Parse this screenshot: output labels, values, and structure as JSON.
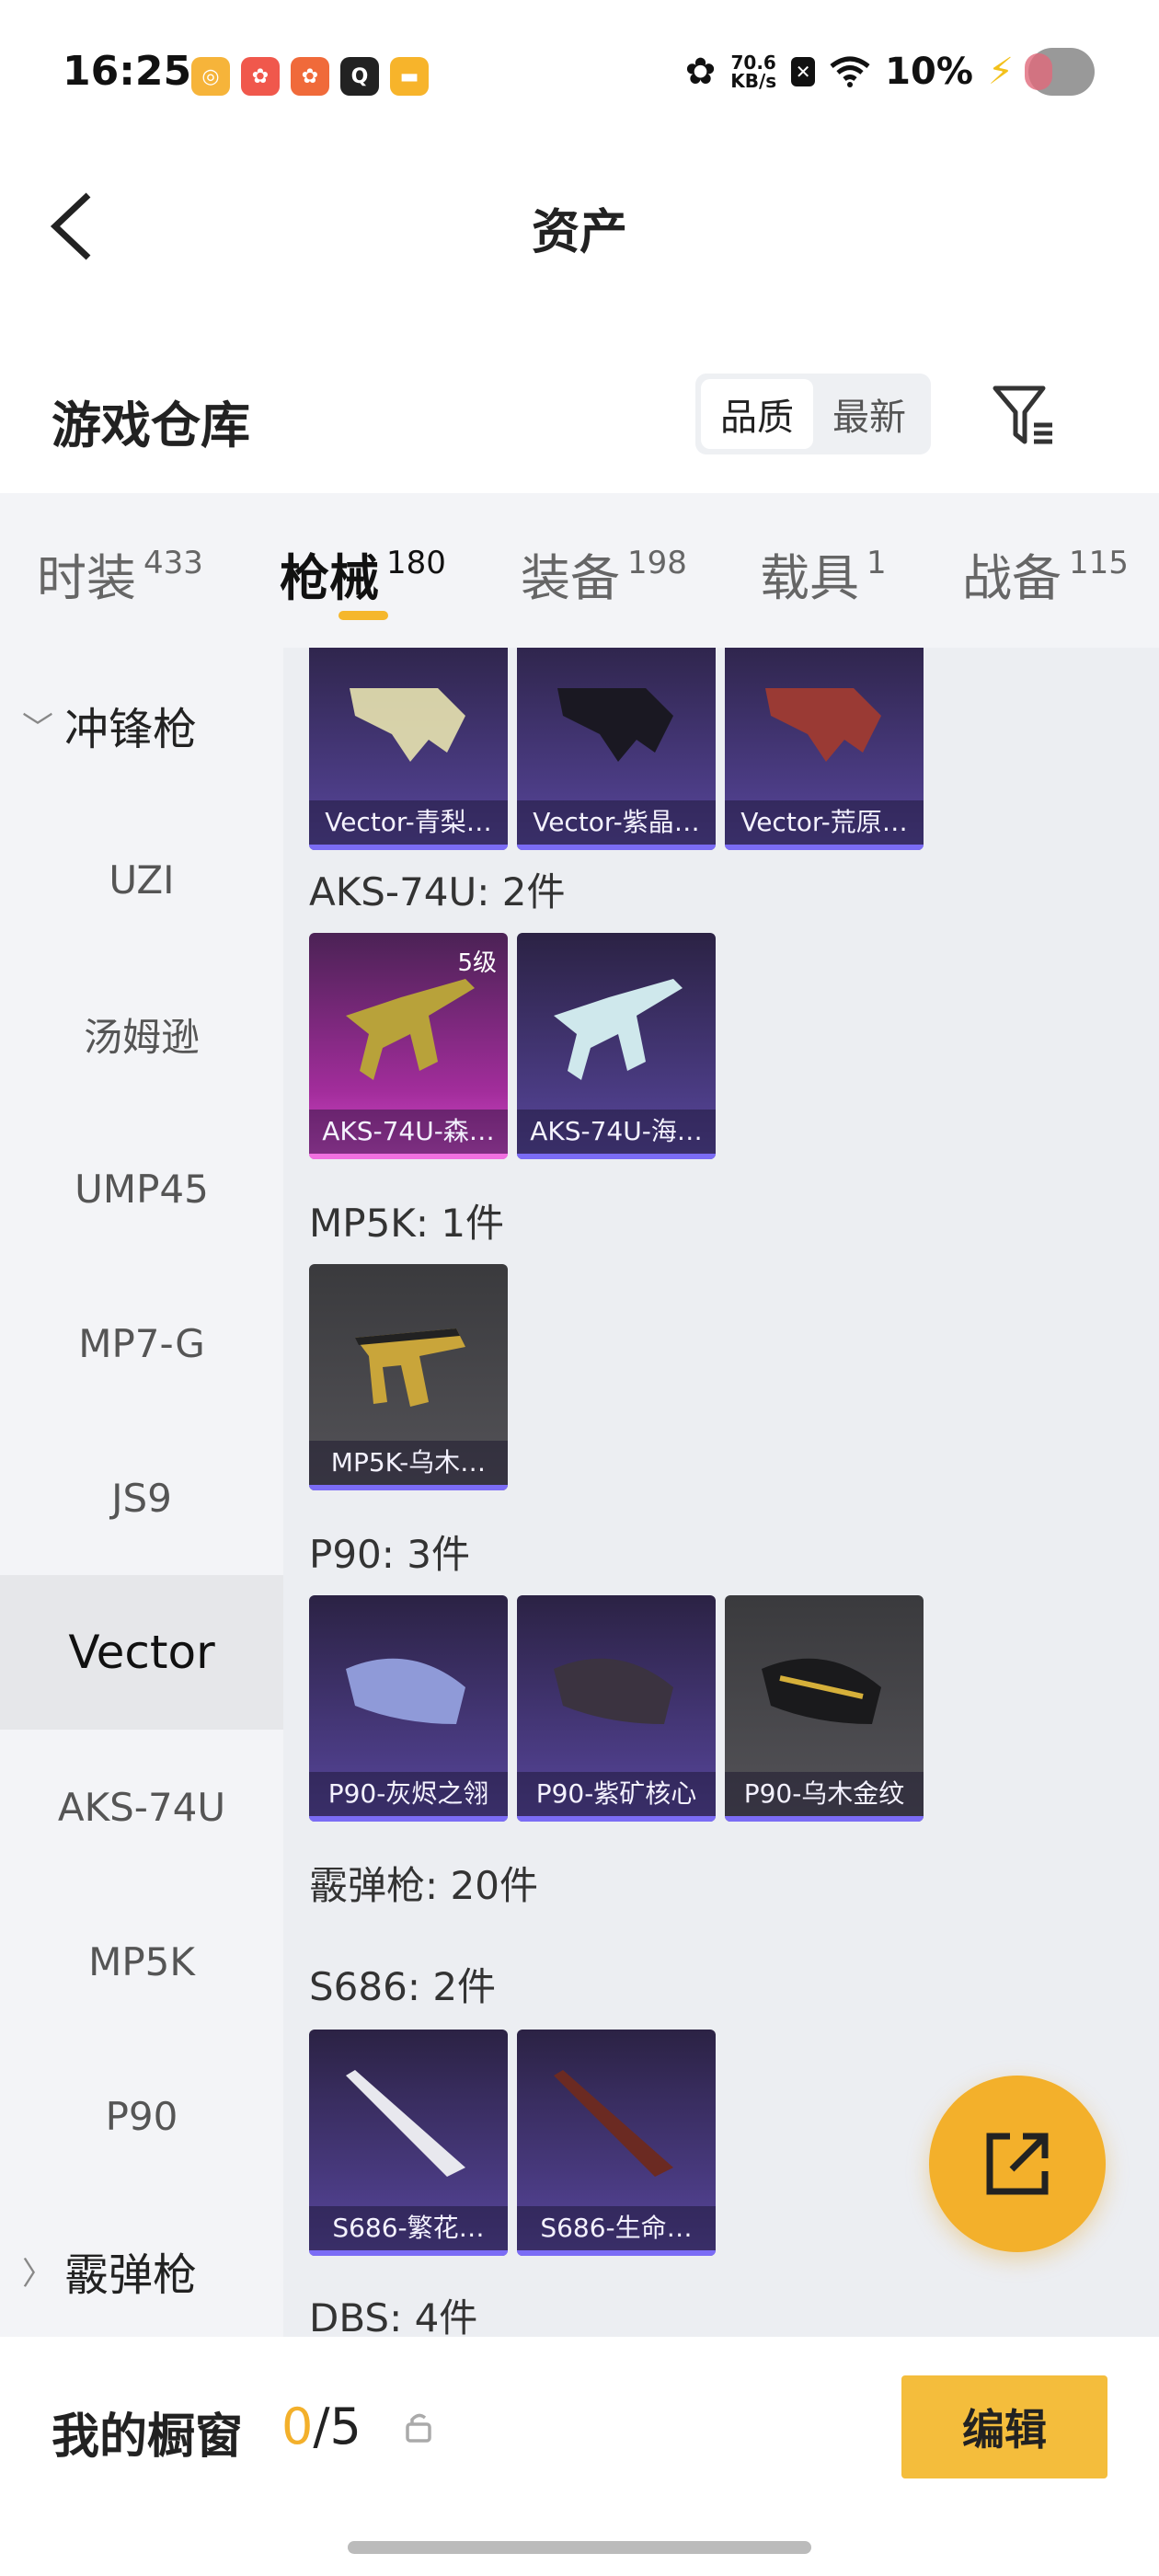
{
  "status_bar": {
    "time": "16:25",
    "net_speed_value": "70.6",
    "net_speed_unit": "KB/s",
    "battery": "10%",
    "app_icons": [
      "app-icon-1",
      "app-icon-2",
      "app-icon-3",
      "app-icon-4",
      "app-icon-5"
    ]
  },
  "header": {
    "title": "资产"
  },
  "warehouse": {
    "title": "游戏仓库",
    "sort_options": [
      "品质",
      "最新"
    ],
    "sort_selected": "品质"
  },
  "tabs": [
    {
      "label": "时装",
      "count": "433"
    },
    {
      "label": "枪械",
      "count": "180",
      "active": true
    },
    {
      "label": "装备",
      "count": "198"
    },
    {
      "label": "载具",
      "count": "1"
    },
    {
      "label": "战备",
      "count": "115"
    }
  ],
  "sidebar": {
    "group_smg": "冲锋枪",
    "items": [
      "UZI",
      "汤姆逊",
      "UMP45",
      "MP7-G",
      "JS9",
      "Vector",
      "AKS-74U",
      "MP5K",
      "P90"
    ],
    "active": "Vector",
    "group_shotgun": "霰弹枪"
  },
  "content": {
    "vector_cards": [
      "Vector-青梨…",
      "Vector-紫晶…",
      "Vector-荒原…"
    ],
    "aks_label": "AKS-74U: 2件",
    "aks_cards": [
      "AKS-74U-森…",
      "AKS-74U-海…"
    ],
    "aks_level": "5级",
    "mp5k_label": "MP5K: 1件",
    "mp5k_cards": [
      "MP5K-乌木…"
    ],
    "p90_label": "P90: 3件",
    "p90_cards": [
      "P90-灰烬之翎",
      "P90-紫矿核心",
      "P90-乌木金纹"
    ],
    "shotgun_label": "霰弹枪: 20件",
    "s686_label": "S686: 2件",
    "s686_cards": [
      "S686-繁花…",
      "S686-生命…"
    ],
    "dbs_label": "DBS: 4件"
  },
  "bottom": {
    "title": "我的橱窗",
    "current": "0",
    "total": "/5",
    "edit_label": "编辑"
  },
  "colors": {
    "accent": "#f3b02b",
    "card_purple": "#4a3b82",
    "card_pink": "#a22d9b",
    "card_gray": "#545358"
  }
}
